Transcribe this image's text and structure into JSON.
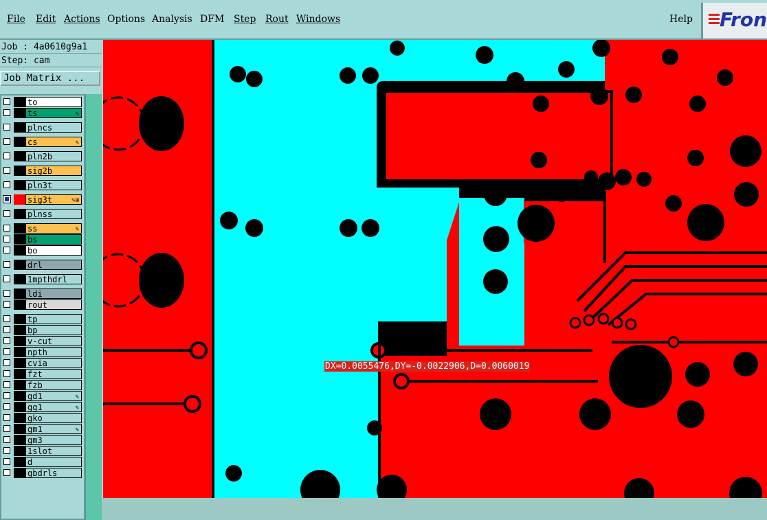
{
  "menu": [
    {
      "label": "File",
      "underline": true
    },
    {
      "label": "Edit",
      "underline": true
    },
    {
      "label": "Actions",
      "underline": true
    },
    {
      "label": "Options",
      "underline": false
    },
    {
      "label": "Analysis",
      "underline": false
    },
    {
      "label": "DFM",
      "underline": false
    },
    {
      "label": "Step",
      "underline": true
    },
    {
      "label": "Rout",
      "underline": true
    },
    {
      "label": "Windows",
      "underline": true
    }
  ],
  "help_label": "Help",
  "logo_text": "Fron",
  "job_label": "Job : 4a0610g9a1",
  "step_label": "Step: cam",
  "matrix_button": "Job Matrix ...",
  "layers": [
    {
      "name": "to",
      "color": "#ffffff",
      "marks": ""
    },
    {
      "name": "ts",
      "color": "#00a070",
      "marks": "✎"
    },
    {
      "name": "plncs",
      "color": "#a8d8d8",
      "marks": ""
    },
    {
      "name": "cs",
      "color": "#ffc050",
      "marks": "✎"
    },
    {
      "name": "pln2b",
      "color": "#a8d8d8",
      "marks": ""
    },
    {
      "name": "sig2b",
      "color": "#ffc050",
      "marks": ""
    },
    {
      "name": "pln3t",
      "color": "#a8d8d8",
      "marks": ""
    },
    {
      "name": "sig3t",
      "color": "#ffc050",
      "marks": "✎⊞",
      "active": true
    },
    {
      "name": "plnss",
      "color": "#a8d8d8",
      "marks": ""
    },
    {
      "name": "ss",
      "color": "#ffc050",
      "marks": "✎"
    },
    {
      "name": "bs",
      "color": "#00a070",
      "marks": ""
    },
    {
      "name": "bo",
      "color": "#ffffff",
      "marks": ""
    },
    {
      "name": "drl",
      "color": "#8fa8b0",
      "marks": ""
    },
    {
      "name": "1mpthdrl",
      "color": "#a8d8d8",
      "marks": ""
    },
    {
      "name": "ldi",
      "color": "#8fa8b0",
      "marks": ""
    },
    {
      "name": "rout",
      "color": "#d8d8d8",
      "marks": ""
    },
    {
      "name": "tp",
      "color": "#a8d8d8",
      "marks": ""
    },
    {
      "name": "bp",
      "color": "#a8d8d8",
      "marks": ""
    },
    {
      "name": "v-cut",
      "color": "#a8d8d8",
      "marks": ""
    },
    {
      "name": "npth",
      "color": "#a8d8d8",
      "marks": ""
    },
    {
      "name": "cvia",
      "color": "#a8d8d8",
      "marks": ""
    },
    {
      "name": "fzt",
      "color": "#a8d8d8",
      "marks": ""
    },
    {
      "name": "fzb",
      "color": "#a8d8d8",
      "marks": ""
    },
    {
      "name": "gd1",
      "color": "#a8d8d8",
      "marks": "✎"
    },
    {
      "name": "gg1",
      "color": "#a8d8d8",
      "marks": "✎"
    },
    {
      "name": "gko",
      "color": "#a8d8d8",
      "marks": ""
    },
    {
      "name": "gm1",
      "color": "#a8d8d8",
      "marks": "✎"
    },
    {
      "name": "gm3",
      "color": "#a8d8d8",
      "marks": ""
    },
    {
      "name": "1slot",
      "color": "#a8d8d8",
      "marks": ""
    },
    {
      "name": "d",
      "color": "#a8d8d8",
      "marks": ""
    },
    {
      "name": "gbdrls",
      "color": "#a8d8d8",
      "marks": ""
    }
  ],
  "measurement": "DX=0.0055476,DY=-0.0022906,D=0.0060019",
  "colors": {
    "copper": "#ff0000",
    "plane": "#00ffff",
    "background": "#000000"
  }
}
